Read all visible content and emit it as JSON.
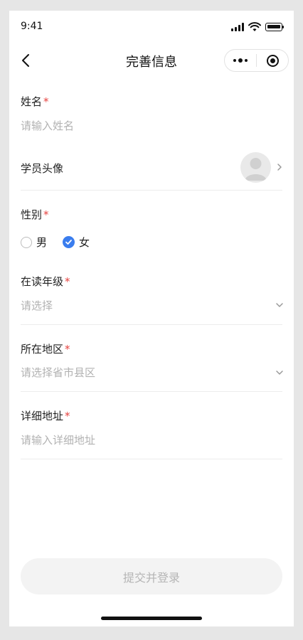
{
  "status_bar": {
    "time": "9:41"
  },
  "nav": {
    "title": "完善信息"
  },
  "form": {
    "name": {
      "label": "姓名",
      "required_mark": "*",
      "placeholder": "请输入姓名"
    },
    "avatar": {
      "label": "学员头像"
    },
    "gender": {
      "label": "性别",
      "required_mark": "*",
      "options": [
        "男",
        "女"
      ],
      "selected": "女"
    },
    "grade": {
      "label": "在读年级",
      "required_mark": "*",
      "placeholder": "请选择"
    },
    "region": {
      "label": "所在地区",
      "required_mark": "*",
      "placeholder": "请选择省市县区"
    },
    "address": {
      "label": "详细地址",
      "required_mark": "*",
      "placeholder": "请输入详细地址"
    }
  },
  "submit": {
    "label": "提交并登录"
  },
  "colors": {
    "accent": "#3a7dee",
    "required": "#e64340",
    "placeholder": "#b2b2b2"
  }
}
